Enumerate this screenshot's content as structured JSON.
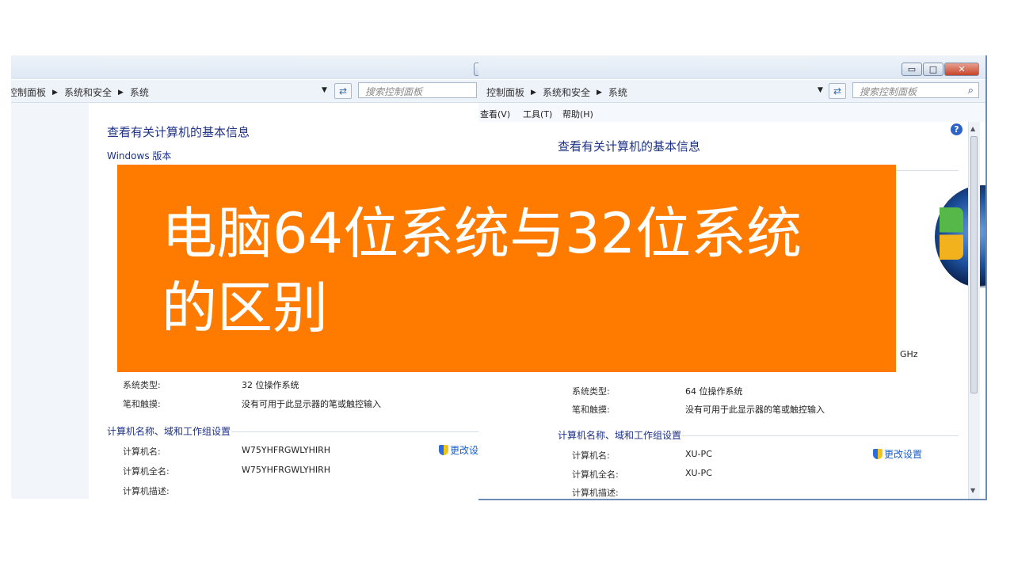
{
  "colors": {
    "banner_bg": "#ff7b00",
    "banner_text": "#ffffff",
    "heading": "#1e3287",
    "link": "#1a5ec9"
  },
  "left_window": {
    "window_controls": {
      "minimize": "▭",
      "maximize": "□",
      "close": "✕"
    },
    "breadcrumb": [
      "控制面板",
      "系统和安全",
      "系统"
    ],
    "search_placeholder": "搜索控制面板",
    "heading": "查看有关计算机的基本信息",
    "windows_edition_label": "Windows 版本",
    "system_type_label": "系统类型:",
    "system_type_value": "32 位操作系统",
    "pen_touch_label": "笔和触摸:",
    "pen_touch_value": "没有可用于此显示器的笔或触控输入",
    "computer_section": "计算机名称、域和工作组设置",
    "computer_name_label": "计算机名:",
    "computer_name_value": "W75YHFRGWLYHIRH",
    "full_name_label": "计算机全名:",
    "full_name_value": "W75YHFRGWLYHIRH",
    "description_label": "计算机描述:",
    "change_settings": "更改设置"
  },
  "right_window": {
    "window_controls": {
      "minimize": "▭",
      "maximize": "□",
      "close": "✕"
    },
    "breadcrumb": [
      "控制面板",
      "系统和安全",
      "系统"
    ],
    "search_placeholder": "搜索控制面板",
    "menu": {
      "view": "查看(V)",
      "tools": "工具(T)",
      "help": "帮助(H)"
    },
    "heading": "查看有关计算机的基本信息",
    "cpu_unit": "GHz",
    "system_type_label": "系统类型:",
    "system_type_value": "64 位操作系统",
    "pen_touch_label": "笔和触摸:",
    "pen_touch_value": "没有可用于此显示器的笔或触控输入",
    "computer_section": "计算机名称、域和工作组设置",
    "computer_name_label": "计算机名:",
    "computer_name_value": "XU-PC",
    "full_name_label": "计算机全名:",
    "full_name_value": "XU-PC",
    "description_label": "计算机描述:",
    "change_settings": "更改设置"
  },
  "banner": {
    "line1": "电脑64位系统与32位系统",
    "line2": "的区别"
  }
}
